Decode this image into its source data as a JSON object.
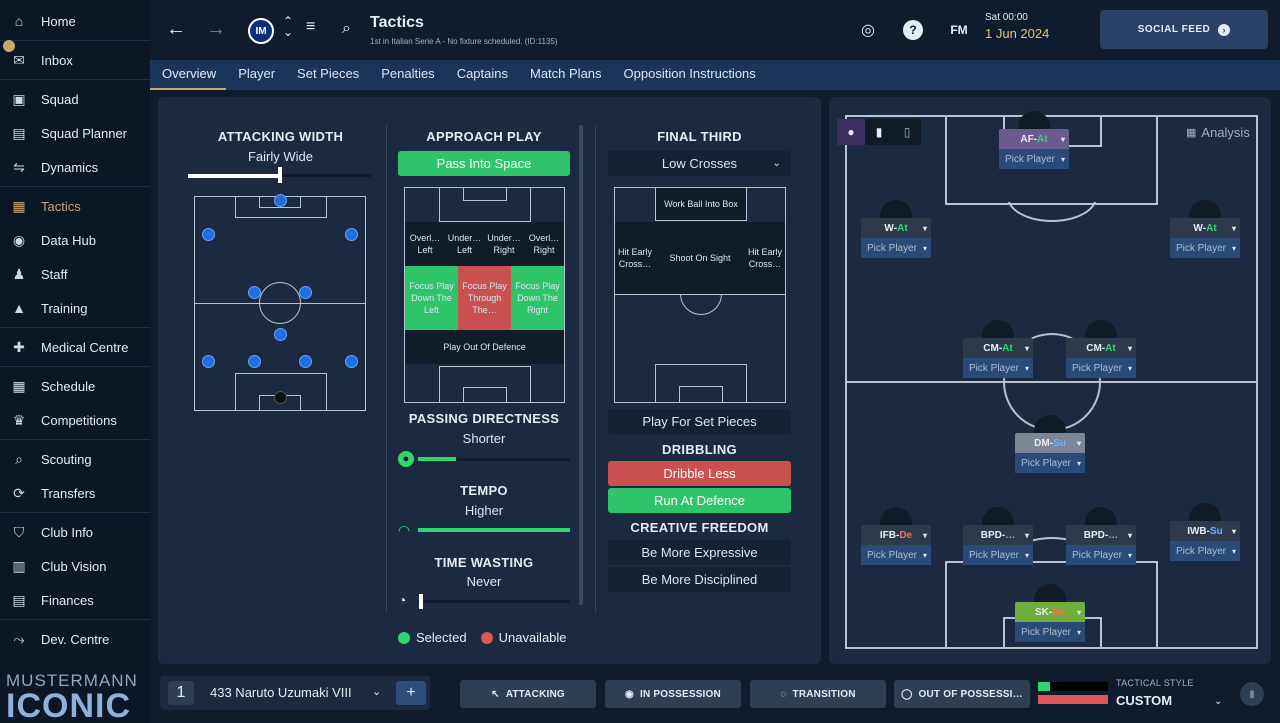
{
  "sidebar": {
    "items": [
      {
        "label": "Home",
        "icon": "home-icon",
        "glyph": "⌂"
      },
      {
        "label": "Inbox",
        "icon": "inbox-icon",
        "glyph": "✉"
      },
      {
        "label": "Squad",
        "icon": "shirt-icon",
        "glyph": "▣"
      },
      {
        "label": "Squad Planner",
        "icon": "clipboard-icon",
        "glyph": "▤"
      },
      {
        "label": "Dynamics",
        "icon": "dynamics-icon",
        "glyph": "⇋"
      },
      {
        "label": "Tactics",
        "icon": "tactics-board-icon",
        "glyph": "▦"
      },
      {
        "label": "Data Hub",
        "icon": "data-hub-icon",
        "glyph": "◉"
      },
      {
        "label": "Staff",
        "icon": "staff-icon",
        "glyph": "♟"
      },
      {
        "label": "Training",
        "icon": "training-cone-icon",
        "glyph": "▲"
      },
      {
        "label": "Medical Centre",
        "icon": "medical-icon",
        "glyph": "✚"
      },
      {
        "label": "Schedule",
        "icon": "calendar-icon",
        "glyph": "▦"
      },
      {
        "label": "Competitions",
        "icon": "trophy-icon",
        "glyph": "♛"
      },
      {
        "label": "Scouting",
        "icon": "search-icon",
        "glyph": "⌕"
      },
      {
        "label": "Transfers",
        "icon": "transfer-icon",
        "glyph": "⟳"
      },
      {
        "label": "Club Info",
        "icon": "shield-icon",
        "glyph": "⛉"
      },
      {
        "label": "Club Vision",
        "icon": "briefcase-icon",
        "glyph": "▥"
      },
      {
        "label": "Finances",
        "icon": "money-icon",
        "glyph": "▤"
      },
      {
        "label": "Dev. Centre",
        "icon": "dev-centre-icon",
        "glyph": "⤳"
      }
    ],
    "brand_top": "MUSTERMANN",
    "brand_big": "ICONIC"
  },
  "header": {
    "title": "Tactics",
    "subtitle": "1st in Italian Serie A - No fixture scheduled. (ID:1135)",
    "club_logo": "IM",
    "fm_label": "FM",
    "date_line1": "Sat 00:00",
    "date_line2": "1 Jun 2024",
    "social_feed": "SOCIAL FEED"
  },
  "tabs": [
    "Overview",
    "Player",
    "Set Pieces",
    "Penalties",
    "Captains",
    "Match Plans",
    "Opposition Instructions"
  ],
  "attacking_width": {
    "title": "ATTACKING WIDTH",
    "value": "Fairly Wide",
    "level": 0.5
  },
  "approach_play": {
    "title": "APPROACH PLAY",
    "selected": "Pass Into Space",
    "zones": {
      "overlap_left": "Overl… Left",
      "underlap_left": "Under… Left",
      "underlap_right": "Under… Right",
      "overlap_right": "Overl… Right",
      "focus_left": "Focus Play Down The Left",
      "focus_center": "Focus Play Through The…",
      "focus_right": "Focus Play Down The Right",
      "play_out": "Play Out Of Defence"
    }
  },
  "passing_directness": {
    "title": "PASSING DIRECTNESS",
    "value": "Shorter",
    "level": 0.25
  },
  "tempo": {
    "title": "TEMPO",
    "value": "Higher",
    "level": 1.0
  },
  "time_wasting": {
    "title": "TIME WASTING",
    "value": "Never",
    "level": 0.0
  },
  "legend": {
    "selected": "Selected",
    "unavailable": "Unavailable"
  },
  "final_third": {
    "title": "FINAL THIRD",
    "dropdown": "Low Crosses",
    "zones": {
      "work_ball": "Work Ball Into Box",
      "hit_early_left": "Hit Early Cross…",
      "shoot": "Shoot On Sight",
      "hit_early_right": "Hit Early Cross…"
    },
    "set_pieces": "Play For Set Pieces"
  },
  "dribbling": {
    "title": "DRIBBLING",
    "less": "Dribble Less",
    "run": "Run At Defence"
  },
  "creative_freedom": {
    "title": "CREATIVE FREEDOM",
    "expressive": "Be More Expressive",
    "disciplined": "Be More Disciplined"
  },
  "formation": {
    "analysis": "Analysis",
    "pick_player": "Pick Player",
    "positions": [
      {
        "pos": "AF",
        "duty": "At"
      },
      {
        "pos": "W",
        "duty": "At"
      },
      {
        "pos": "W",
        "duty": "At"
      },
      {
        "pos": "CM",
        "duty": "At"
      },
      {
        "pos": "CM",
        "duty": "At"
      },
      {
        "pos": "DM",
        "duty": "Su"
      },
      {
        "pos": "IFB",
        "duty": "De"
      },
      {
        "pos": "BPD",
        "duty": "…"
      },
      {
        "pos": "BPD",
        "duty": "…"
      },
      {
        "pos": "IWB",
        "duty": "Su"
      },
      {
        "pos": "SK",
        "duty": "De"
      }
    ]
  },
  "bottom": {
    "slot": "1",
    "tactic_name": "433 Naruto Uzumaki VIII",
    "add": "+",
    "attacking": "ATTACKING",
    "in_possession": "IN POSSESSION",
    "transition": "TRANSITION",
    "out_possession": "OUT OF POSSESSI…",
    "style_label": "TACTICAL STYLE",
    "style_value": "CUSTOM"
  },
  "colors": {
    "accent": "#c9a86b",
    "green": "#2dc46a",
    "red": "#c9514f",
    "blue_dot": "#1f6fe0"
  }
}
